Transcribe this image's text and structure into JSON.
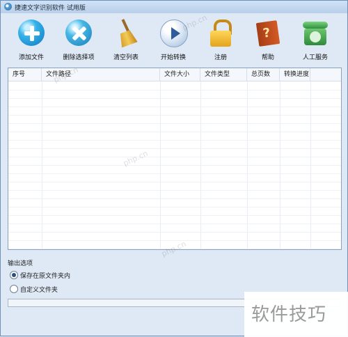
{
  "window": {
    "title": "捷速文字识别软件 试用版"
  },
  "toolbar": {
    "items": [
      {
        "label": "添加文件",
        "icon": "add-icon"
      },
      {
        "label": "删除选择项",
        "icon": "delete-icon"
      },
      {
        "label": "清空列表",
        "icon": "broom-icon"
      },
      {
        "label": "开始转换",
        "icon": "play-icon"
      },
      {
        "label": "注册",
        "icon": "lock-icon"
      },
      {
        "label": "帮助",
        "icon": "help-book-icon"
      },
      {
        "label": "人工服务",
        "icon": "phone-icon"
      }
    ]
  },
  "table": {
    "columns": [
      "序号",
      "文件路径",
      "文件大小",
      "文件类型",
      "总页数",
      "转换进度"
    ],
    "rows": []
  },
  "output": {
    "title": "输出选项",
    "options": [
      {
        "label": "保存在原文件夹内",
        "selected": true
      },
      {
        "label": "自定义文件夹",
        "selected": false
      }
    ]
  },
  "status": {
    "progress_percent": 0
  },
  "watermarks": {
    "overlay_text": "软件技巧",
    "site_text": "php.cn"
  },
  "colors": {
    "accent": "#35b3ea",
    "window_bg": "#dfe9f5",
    "border": "#8aa1bd"
  }
}
